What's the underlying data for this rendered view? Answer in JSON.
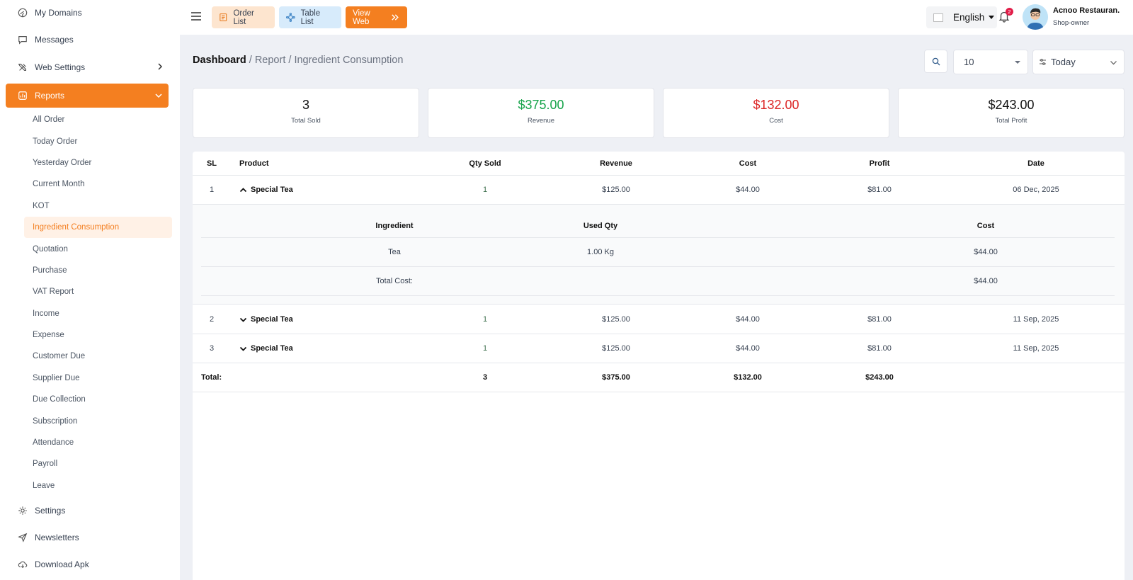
{
  "sidebar": {
    "items": [
      {
        "label": "My Domains",
        "icon": "globe-icon"
      },
      {
        "label": "Messages",
        "icon": "message-icon"
      },
      {
        "label": "Web Settings",
        "icon": "tools-icon"
      },
      {
        "label": "Reports",
        "icon": "report-icon"
      }
    ],
    "sub_items": [
      "All Order",
      "Today Order",
      "Yesterday Order",
      "Current Month",
      "KOT",
      "Ingredient Consumption",
      "Quotation",
      "Purchase",
      "VAT Report",
      "Income",
      "Expense",
      "Customer Due",
      "Supplier Due",
      "Due Collection",
      "Subscription",
      "Attendance",
      "Payroll",
      "Leave"
    ],
    "bottom_items": [
      {
        "label": "Settings",
        "icon": "gear-icon"
      },
      {
        "label": "Newsletters",
        "icon": "send-icon"
      },
      {
        "label": "Download Apk",
        "icon": "cloud-download-icon"
      }
    ]
  },
  "topbar": {
    "order_list": "Order List",
    "table_list": "Table List",
    "view_web": "View Web",
    "language": "English",
    "notification_count": "2",
    "user_name": "Acnoo Restauran.",
    "user_role": "Shop-owner"
  },
  "breadcrumb": {
    "home": "Dashboard",
    "rest": " / Report / Ingredient Consumption"
  },
  "filters": {
    "per_page": "10",
    "period": "Today"
  },
  "stats": [
    {
      "value": "3",
      "label": "Total Sold",
      "color": "#111111"
    },
    {
      "value": "$375.00",
      "label": "Revenue",
      "color": "#16a34a"
    },
    {
      "value": "$132.00",
      "label": "Cost",
      "color": "#dc2626"
    },
    {
      "value": "$243.00",
      "label": "Total Profit",
      "color": "#111111"
    }
  ],
  "table": {
    "headers": {
      "sl": "SL",
      "product": "Product",
      "qty": "Qty Sold",
      "revenue": "Revenue",
      "cost": "Cost",
      "profit": "Profit",
      "date": "Date"
    },
    "rows": [
      {
        "sl": "1",
        "product": "Special Tea",
        "qty": "1",
        "revenue": "$125.00",
        "cost": "$44.00",
        "profit": "$81.00",
        "date": "06 Dec, 2025"
      },
      {
        "sl": "2",
        "product": "Special Tea",
        "qty": "1",
        "revenue": "$125.00",
        "cost": "$44.00",
        "profit": "$81.00",
        "date": "11 Sep, 2025"
      },
      {
        "sl": "3",
        "product": "Special Tea",
        "qty": "1",
        "revenue": "$125.00",
        "cost": "$44.00",
        "profit": "$81.00",
        "date": "11 Sep, 2025"
      }
    ],
    "detail": {
      "headers": {
        "ingredient": "Ingredient",
        "used_qty": "Used Qty",
        "cost": "Cost"
      },
      "row": {
        "ingredient": "Tea",
        "used_qty": "1.00 Kg",
        "cost": "$44.00"
      },
      "total_label": "Total Cost:",
      "total_value": "$44.00"
    },
    "footer": {
      "label": "Total:",
      "qty": "3",
      "revenue": "$375.00",
      "cost": "$132.00",
      "profit": "$243.00"
    }
  }
}
